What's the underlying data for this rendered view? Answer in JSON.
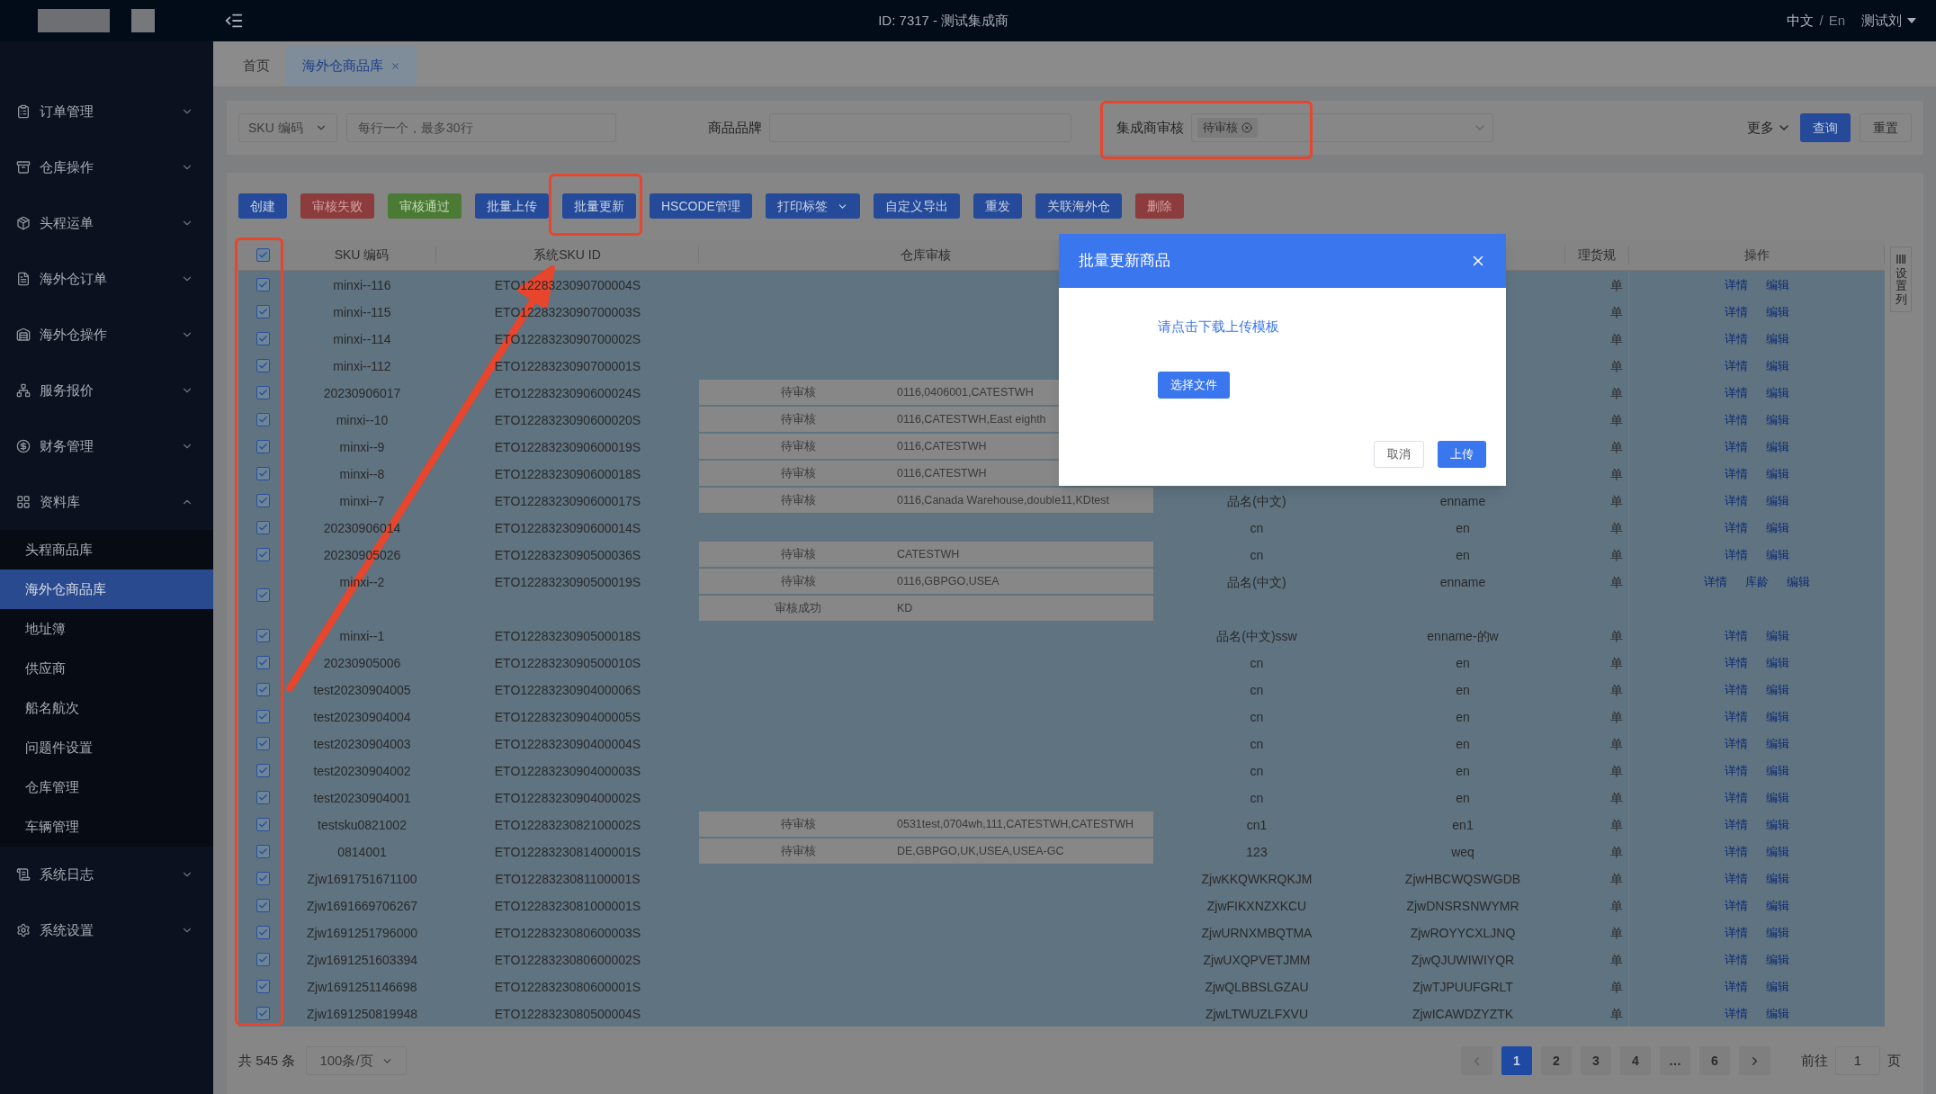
{
  "header": {
    "title": "ID: 7317 - 测试集成商",
    "languages": [
      {
        "label": "中文",
        "selected": true
      },
      {
        "label": "En",
        "selected": false
      }
    ],
    "language_separator": "/",
    "user": "测试刘"
  },
  "sidebar": {
    "items": [
      {
        "label": "订单管理",
        "expanded": false
      },
      {
        "label": "仓库操作",
        "expanded": false
      },
      {
        "label": "头程运单",
        "expanded": false
      },
      {
        "label": "海外仓订单",
        "expanded": false
      },
      {
        "label": "海外仓操作",
        "expanded": false
      },
      {
        "label": "服务报价",
        "expanded": false
      },
      {
        "label": "财务管理",
        "expanded": false
      },
      {
        "label": "资料库",
        "expanded": true,
        "children": [
          {
            "label": "头程商品库",
            "selected": false
          },
          {
            "label": "海外仓商品库",
            "selected": true
          },
          {
            "label": "地址簿",
            "selected": false
          },
          {
            "label": "供应商",
            "selected": false
          },
          {
            "label": "船名航次",
            "selected": false
          },
          {
            "label": "问题件设置",
            "selected": false
          },
          {
            "label": "仓库管理",
            "selected": false
          },
          {
            "label": "车辆管理",
            "selected": false
          }
        ]
      },
      {
        "label": "系统日志",
        "expanded": false
      },
      {
        "label": "系统设置",
        "expanded": false
      }
    ]
  },
  "tabs": [
    {
      "label": "首页",
      "selected": false,
      "closable": false
    },
    {
      "label": "海外仓商品库",
      "selected": true,
      "closable": true
    }
  ],
  "filters": {
    "sku_select": "SKU 编码",
    "sku_placeholder": "每行一个，最多30行",
    "brand_label": "商品品牌",
    "audit_label": "集成商审核",
    "audit_tags": [
      "待审核"
    ],
    "more": "更多",
    "query": "查询",
    "reset": "重置"
  },
  "toolbar": [
    {
      "label": "创建",
      "kind": "primary"
    },
    {
      "label": "审核失败",
      "kind": "danger"
    },
    {
      "label": "审核通过",
      "kind": "success"
    },
    {
      "label": "批量上传",
      "kind": "primary"
    },
    {
      "label": "批量更新",
      "kind": "primary"
    },
    {
      "label": "HSCODE管理",
      "kind": "primary"
    },
    {
      "label": "打印标签",
      "kind": "dropdown"
    },
    {
      "label": "自定义导出",
      "kind": "primary"
    },
    {
      "label": "重发",
      "kind": "primary"
    },
    {
      "label": "关联海外仓",
      "kind": "primary"
    },
    {
      "label": "删除",
      "kind": "danger"
    }
  ],
  "table": {
    "all_checked": true,
    "columns": [
      "SKU 编码",
      "系统SKU ID",
      "仓库审核",
      "理货规",
      "操作"
    ],
    "column_settings": "设置列",
    "rows": [
      {
        "checked": true,
        "selected": true,
        "sku": "minxi--116",
        "system_id": "ETO1228323090700004S",
        "unit": "单",
        "actions": [
          "详情",
          "编辑"
        ]
      },
      {
        "checked": true,
        "selected": true,
        "sku": "minxi--115",
        "system_id": "ETO1228323090700003S",
        "unit": "单",
        "actions": [
          "详情",
          "编辑"
        ]
      },
      {
        "checked": true,
        "selected": true,
        "sku": "minxi--114",
        "system_id": "ETO1228323090700002S",
        "unit": "单",
        "actions": [
          "详情",
          "编辑"
        ]
      },
      {
        "checked": true,
        "selected": true,
        "sku": "minxi--112",
        "system_id": "ETO1228323090700001S",
        "unit": "单",
        "actions": [
          "详情",
          "编辑"
        ]
      },
      {
        "checked": true,
        "selected": true,
        "sku": "20230906017",
        "system_id": "ETO1228323090600024S",
        "audits": [
          {
            "status": "待审核",
            "warehouses": "0116,0406001,CATESTWH"
          }
        ],
        "unit": "单",
        "actions": [
          "详情",
          "编辑"
        ]
      },
      {
        "checked": true,
        "selected": true,
        "sku": "minxi--10",
        "system_id": "ETO1228323090600020S",
        "audits": [
          {
            "status": "待审核",
            "warehouses": "0116,CATESTWH,East eighth"
          }
        ],
        "unit": "单",
        "actions": [
          "详情",
          "编辑"
        ]
      },
      {
        "checked": true,
        "selected": true,
        "sku": "minxi--9",
        "system_id": "ETO1228323090600019S",
        "audits": [
          {
            "status": "待审核",
            "warehouses": "0116,CATESTWH"
          }
        ],
        "unit": "单",
        "actions": [
          "详情",
          "编辑"
        ]
      },
      {
        "checked": true,
        "selected": true,
        "sku": "minxi--8",
        "system_id": "ETO1228323090600018S",
        "audits": [
          {
            "status": "待审核",
            "warehouses": "0116,CATESTWH"
          }
        ],
        "unit": "单",
        "actions": [
          "详情",
          "编辑"
        ]
      },
      {
        "checked": true,
        "selected": true,
        "sku": "minxi--7",
        "system_id": "ETO1228323090600017S",
        "audits": [
          {
            "status": "待审核",
            "warehouses": "0116,Canada Warehouse,double11,KDtest"
          }
        ],
        "name_cn": "品名(中文)",
        "name_en": "enname",
        "unit": "单",
        "actions": [
          "详情",
          "编辑"
        ]
      },
      {
        "checked": true,
        "selected": true,
        "sku": "20230906014",
        "system_id": "ETO1228323090600014S",
        "name_cn": "cn",
        "name_en": "en",
        "unit": "单",
        "actions": [
          "详情",
          "编辑"
        ]
      },
      {
        "checked": true,
        "selected": true,
        "sku": "20230905026",
        "system_id": "ETO1228323090500036S",
        "audits": [
          {
            "status": "待审核",
            "warehouses": "CATESTWH"
          }
        ],
        "name_cn": "cn",
        "name_en": "en",
        "unit": "单",
        "actions": [
          "详情",
          "编辑"
        ]
      },
      {
        "checked": true,
        "selected": true,
        "sku": "minxi--2",
        "system_id": "ETO1228323090500019S",
        "audits": [
          {
            "status": "待审核",
            "warehouses": "0116,GBPGO,USEA"
          },
          {
            "status": "审核成功",
            "warehouses": "KD"
          }
        ],
        "name_cn": "品名(中文)",
        "name_en": "enname",
        "unit": "单",
        "actions": [
          "详情",
          "库龄",
          "编辑"
        ]
      },
      {
        "checked": true,
        "selected": true,
        "sku": "minxi--1",
        "system_id": "ETO1228323090500018S",
        "name_cn": "品名(中文)ssw",
        "name_en": "enname-的w",
        "unit": "单",
        "actions": [
          "详情",
          "编辑"
        ]
      },
      {
        "checked": true,
        "selected": true,
        "sku": "20230905006",
        "system_id": "ETO1228323090500010S",
        "name_cn": "cn",
        "name_en": "en",
        "unit": "单",
        "actions": [
          "详情",
          "编辑"
        ]
      },
      {
        "checked": true,
        "selected": true,
        "sku": "test20230904005",
        "system_id": "ETO1228323090400006S",
        "name_cn": "cn",
        "name_en": "en",
        "unit": "单",
        "actions": [
          "详情",
          "编辑"
        ]
      },
      {
        "checked": true,
        "selected": true,
        "sku": "test20230904004",
        "system_id": "ETO1228323090400005S",
        "name_cn": "cn",
        "name_en": "en",
        "unit": "单",
        "actions": [
          "详情",
          "编辑"
        ]
      },
      {
        "checked": true,
        "selected": true,
        "sku": "test20230904003",
        "system_id": "ETO1228323090400004S",
        "name_cn": "cn",
        "name_en": "en",
        "unit": "单",
        "actions": [
          "详情",
          "编辑"
        ]
      },
      {
        "checked": true,
        "selected": true,
        "sku": "test20230904002",
        "system_id": "ETO1228323090400003S",
        "name_cn": "cn",
        "name_en": "en",
        "unit": "单",
        "actions": [
          "详情",
          "编辑"
        ]
      },
      {
        "checked": true,
        "selected": true,
        "sku": "test20230904001",
        "system_id": "ETO1228323090400002S",
        "name_cn": "cn",
        "name_en": "en",
        "unit": "单",
        "actions": [
          "详情",
          "编辑"
        ]
      },
      {
        "checked": true,
        "selected": true,
        "sku": "testsku0821002",
        "system_id": "ETO1228323082100002S",
        "audits": [
          {
            "status": "待审核",
            "warehouses": "0531test,0704wh,111,CATESTWH,CATESTWH"
          }
        ],
        "name_cn": "cn1",
        "name_en": "en1",
        "unit": "单",
        "actions": [
          "详情",
          "编辑"
        ]
      },
      {
        "checked": true,
        "selected": true,
        "sku": "0814001",
        "system_id": "ETO1228323081400001S",
        "audits": [
          {
            "status": "待审核",
            "warehouses": "DE,GBPGO,UK,USEA,USEA-GC"
          }
        ],
        "name_cn": "123",
        "name_en": "weq",
        "unit": "单",
        "actions": [
          "详情",
          "编辑"
        ]
      },
      {
        "checked": true,
        "selected": true,
        "sku": "Zjw1691751671100",
        "system_id": "ETO1228323081100001S",
        "name_cn": "ZjwKKQWKRQKJM",
        "name_en": "ZjwHBCWQSWGDB",
        "unit": "单",
        "actions": [
          "详情",
          "编辑"
        ]
      },
      {
        "checked": true,
        "selected": true,
        "sku": "Zjw1691669706267",
        "system_id": "ETO1228323081000001S",
        "name_cn": "ZjwFIKXNZXKCU",
        "name_en": "ZjwDNSRSNWYMR",
        "unit": "单",
        "actions": [
          "详情",
          "编辑"
        ]
      },
      {
        "checked": true,
        "selected": true,
        "sku": "Zjw1691251796000",
        "system_id": "ETO1228323080600003S",
        "name_cn": "ZjwURNXMBQTMA",
        "name_en": "ZjwROYYCXLJNQ",
        "unit": "单",
        "actions": [
          "详情",
          "编辑"
        ]
      },
      {
        "checked": true,
        "selected": true,
        "sku": "Zjw1691251603394",
        "system_id": "ETO1228323080600002S",
        "name_cn": "ZjwUXQPVETJMM",
        "name_en": "ZjwQJUWIWIYQR",
        "unit": "单",
        "actions": [
          "详情",
          "编辑"
        ]
      },
      {
        "checked": true,
        "selected": true,
        "sku": "Zjw1691251146698",
        "system_id": "ETO1228323080600001S",
        "name_cn": "ZjwQLBBSLGZAU",
        "name_en": "ZjwTJPUUFGRLT",
        "unit": "单",
        "actions": [
          "详情",
          "编辑"
        ]
      },
      {
        "checked": true,
        "selected": true,
        "sku": "Zjw1691250819948",
        "system_id": "ETO1228323080500004S",
        "name_cn": "ZjwLTWUZLFXVU",
        "name_en": "ZjwICAWDZYZTK",
        "unit": "单",
        "actions": [
          "详情",
          "编辑"
        ]
      }
    ]
  },
  "pagination": {
    "total": "共 545 条",
    "page_size": "100条/页",
    "pages": [
      {
        "label": "1",
        "selected": true
      },
      {
        "label": "2",
        "selected": false
      },
      {
        "label": "3",
        "selected": false
      },
      {
        "label": "4",
        "selected": false
      },
      {
        "label": "…",
        "selected": false
      },
      {
        "label": "6",
        "selected": false
      }
    ],
    "goto_label": "前往",
    "goto_value": "1",
    "goto_suffix": "页"
  },
  "modal": {
    "title": "批量更新商品",
    "template_link": "请点击下载上传模板",
    "choose_file": "选择文件",
    "cancel": "取消",
    "upload": "上传"
  }
}
